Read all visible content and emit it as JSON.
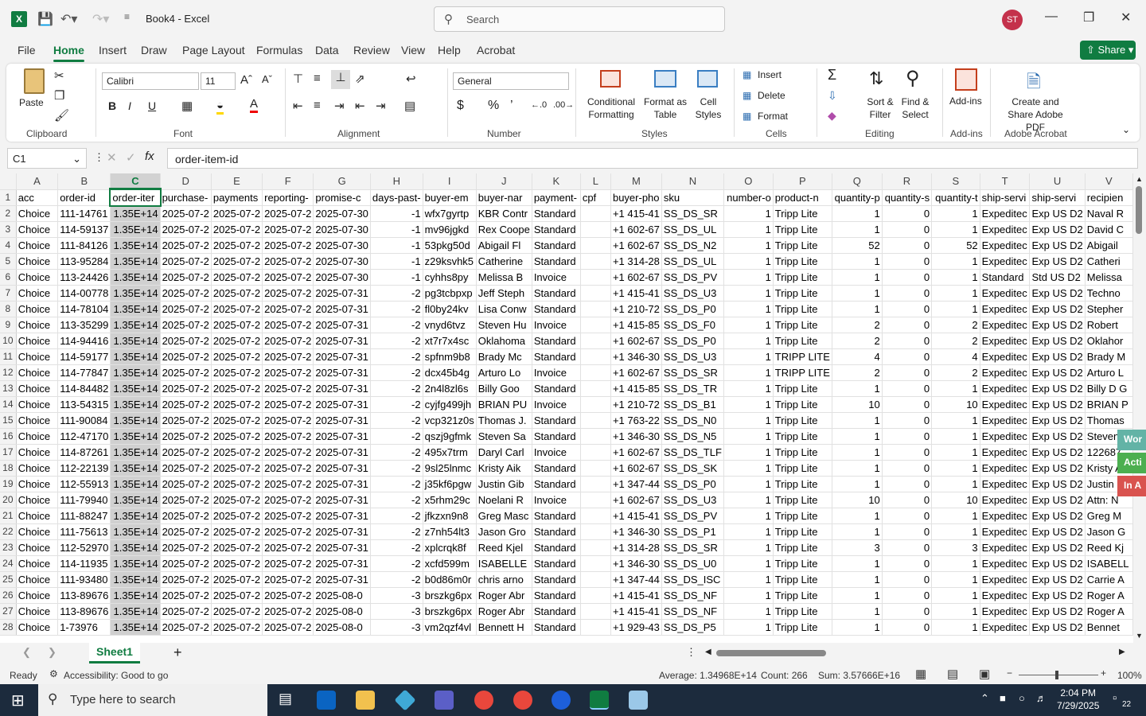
{
  "window": {
    "title": "Book4  -  Excel",
    "search_placeholder": "Search",
    "avatar_initials": "ST"
  },
  "menu_tabs": [
    "File",
    "Home",
    "Insert",
    "Draw",
    "Page Layout",
    "Formulas",
    "Data",
    "Review",
    "View",
    "Help",
    "Acrobat"
  ],
  "share_label": "Share",
  "ribbon": {
    "clipboard": {
      "paste": "Paste",
      "label": "Clipboard"
    },
    "font": {
      "name": "Calibri",
      "size": "11",
      "label": "Font"
    },
    "alignment": {
      "label": "Alignment"
    },
    "number": {
      "format": "General",
      "label": "Number"
    },
    "styles": {
      "conditional": "Conditional Formatting",
      "format_table": "Format as Table",
      "cell_styles": "Cell Styles",
      "label": "Styles"
    },
    "cells": {
      "insert": "Insert",
      "delete": "Delete",
      "format": "Format",
      "label": "Cells"
    },
    "editing": {
      "sort": "Sort & Filter",
      "find": "Find & Select",
      "label": "Editing"
    },
    "addins": {
      "button": "Add-ins",
      "label": "Add-ins"
    },
    "acrobat": {
      "button": "Create and Share Adobe PDF",
      "label": "Adobe Acrobat"
    }
  },
  "formula_bar": {
    "name_box": "C1",
    "formula": "order-item-id"
  },
  "columns": [
    "A",
    "B",
    "C",
    "D",
    "E",
    "F",
    "G",
    "H",
    "I",
    "J",
    "K",
    "L",
    "M",
    "N",
    "O",
    "P",
    "Q",
    "R",
    "S",
    "T",
    "U",
    "V"
  ],
  "headers": [
    "acc",
    "order-id",
    "order-iter",
    "purchase-",
    "payments",
    "reporting-",
    "promise-c",
    "days-past-",
    "buyer-em",
    "buyer-nar",
    "payment-",
    "cpf",
    "buyer-pho",
    "sku",
    "number-o",
    "product-n",
    "quantity-p",
    "quantity-s",
    "quantity-t",
    "ship-servi",
    "ship-servi",
    "recipien"
  ],
  "rows": [
    [
      "Choice",
      "111-14761",
      "1.35E+14",
      "2025-07-2",
      "2025-07-2",
      "2025-07-2",
      "2025-07-30",
      "-1",
      "wfx7gyrtp",
      "KBR Contr",
      "Standard",
      "",
      "+1 415-41",
      "SS_DS_SR",
      "1",
      "Tripp Lite",
      "1",
      "0",
      "1",
      "Expeditec",
      "Exp US D2",
      "Naval R"
    ],
    [
      "Choice",
      "114-59137",
      "1.35E+14",
      "2025-07-2",
      "2025-07-2",
      "2025-07-2",
      "2025-07-30",
      "-1",
      "mv96jgkd",
      "Rex Coope",
      "Standard",
      "",
      "+1 602-67",
      "SS_DS_UL",
      "1",
      "Tripp Lite",
      "1",
      "0",
      "1",
      "Expeditec",
      "Exp US D2",
      "David C"
    ],
    [
      "Choice",
      "111-84126",
      "1.35E+14",
      "2025-07-2",
      "2025-07-2",
      "2025-07-2",
      "2025-07-30",
      "-1",
      "53pkg50d",
      "Abigail Fl",
      "Standard",
      "",
      "+1 602-67",
      "SS_DS_N2",
      "1",
      "Tripp Lite",
      "52",
      "0",
      "52",
      "Expeditec",
      "Exp US D2",
      "Abigail"
    ],
    [
      "Choice",
      "113-95284",
      "1.35E+14",
      "2025-07-2",
      "2025-07-2",
      "2025-07-2",
      "2025-07-30",
      "-1",
      "z29ksvhk5",
      "Catherine",
      "Standard",
      "",
      "+1 314-28",
      "SS_DS_UL",
      "1",
      "Tripp Lite",
      "1",
      "0",
      "1",
      "Expeditec",
      "Exp US D2",
      "Catheri"
    ],
    [
      "Choice",
      "113-24426",
      "1.35E+14",
      "2025-07-2",
      "2025-07-2",
      "2025-07-2",
      "2025-07-30",
      "-1",
      "cyhhs8py",
      "Melissa B",
      "Invoice",
      "",
      "+1 602-67",
      "SS_DS_PV",
      "1",
      "Tripp Lite",
      "1",
      "0",
      "1",
      "Standard",
      "Std US D2",
      "Melissa"
    ],
    [
      "Choice",
      "114-00778",
      "1.35E+14",
      "2025-07-2",
      "2025-07-2",
      "2025-07-2",
      "2025-07-31",
      "-2",
      "pg3tcbpxp",
      "Jeff Steph",
      "Standard",
      "",
      "+1 415-41",
      "SS_DS_U3",
      "1",
      "Tripp Lite",
      "1",
      "0",
      "1",
      "Expeditec",
      "Exp US D2",
      "Techno"
    ],
    [
      "Choice",
      "114-78104",
      "1.35E+14",
      "2025-07-2",
      "2025-07-2",
      "2025-07-2",
      "2025-07-31",
      "-2",
      "fl0by24kv",
      "Lisa Conw",
      "Standard",
      "",
      "+1 210-72",
      "SS_DS_P0",
      "1",
      "Tripp Lite",
      "1",
      "0",
      "1",
      "Expeditec",
      "Exp US D2",
      "Stepher"
    ],
    [
      "Choice",
      "113-35299",
      "1.35E+14",
      "2025-07-2",
      "2025-07-2",
      "2025-07-2",
      "2025-07-31",
      "-2",
      "vnyd6tvz",
      "Steven Hu",
      "Invoice",
      "",
      "+1 415-85",
      "SS_DS_F0",
      "1",
      "Tripp Lite",
      "2",
      "0",
      "2",
      "Expeditec",
      "Exp US D2",
      "Robert"
    ],
    [
      "Choice",
      "114-94416",
      "1.35E+14",
      "2025-07-2",
      "2025-07-2",
      "2025-07-2",
      "2025-07-31",
      "-2",
      "xt7r7x4sc",
      "Oklahoma",
      "Standard",
      "",
      "+1 602-67",
      "SS_DS_P0",
      "1",
      "Tripp Lite",
      "2",
      "0",
      "2",
      "Expeditec",
      "Exp US D2",
      "Oklahor"
    ],
    [
      "Choice",
      "114-59177",
      "1.35E+14",
      "2025-07-2",
      "2025-07-2",
      "2025-07-2",
      "2025-07-31",
      "-2",
      "spfnm9b8",
      "Brady Mc",
      "Standard",
      "",
      "+1 346-30",
      "SS_DS_U3",
      "1",
      "TRIPP LITE",
      "4",
      "0",
      "4",
      "Expeditec",
      "Exp US D2",
      "Brady M"
    ],
    [
      "Choice",
      "114-77847",
      "1.35E+14",
      "2025-07-2",
      "2025-07-2",
      "2025-07-2",
      "2025-07-31",
      "-2",
      "dcx45b4g",
      "Arturo Lo",
      "Invoice",
      "",
      "+1 602-67",
      "SS_DS_SR",
      "1",
      "TRIPP LITE",
      "2",
      "0",
      "2",
      "Expeditec",
      "Exp US D2",
      "Arturo L"
    ],
    [
      "Choice",
      "114-84482",
      "1.35E+14",
      "2025-07-2",
      "2025-07-2",
      "2025-07-2",
      "2025-07-31",
      "-2",
      "2n4l8zl6s",
      "Billy Goo",
      "Standard",
      "",
      "+1 415-85",
      "SS_DS_TR",
      "1",
      "Tripp Lite",
      "1",
      "0",
      "1",
      "Expeditec",
      "Exp US D2",
      "Billy D G"
    ],
    [
      "Choice",
      "113-54315",
      "1.35E+14",
      "2025-07-2",
      "2025-07-2",
      "2025-07-2",
      "2025-07-31",
      "-2",
      "cyjfg499jh",
      "BRIAN PU",
      "Invoice",
      "",
      "+1 210-72",
      "SS_DS_B1",
      "1",
      "Tripp Lite",
      "10",
      "0",
      "10",
      "Expeditec",
      "Exp US D2",
      "BRIAN P"
    ],
    [
      "Choice",
      "111-90084",
      "1.35E+14",
      "2025-07-2",
      "2025-07-2",
      "2025-07-2",
      "2025-07-31",
      "-2",
      "vcp321z0s",
      "Thomas J.",
      "Standard",
      "",
      "+1 763-22",
      "SS_DS_N0",
      "1",
      "Tripp Lite",
      "1",
      "0",
      "1",
      "Expeditec",
      "Exp US D2",
      "Thomas"
    ],
    [
      "Choice",
      "112-47170",
      "1.35E+14",
      "2025-07-2",
      "2025-07-2",
      "2025-07-2",
      "2025-07-31",
      "-2",
      "qszj9gfmk",
      "Steven Sa",
      "Standard",
      "",
      "+1 346-30",
      "SS_DS_N5",
      "1",
      "Tripp Lite",
      "1",
      "0",
      "1",
      "Expeditec",
      "Exp US D2",
      "Steven"
    ],
    [
      "Choice",
      "114-87261",
      "1.35E+14",
      "2025-07-2",
      "2025-07-2",
      "2025-07-2",
      "2025-07-31",
      "-2",
      "495x7trm",
      "Daryl Carl",
      "Invoice",
      "",
      "+1 602-67",
      "SS_DS_TLF",
      "1",
      "Tripp Lite",
      "1",
      "0",
      "1",
      "Expeditec",
      "Exp US D2",
      "122687"
    ],
    [
      "Choice",
      "112-22139",
      "1.35E+14",
      "2025-07-2",
      "2025-07-2",
      "2025-07-2",
      "2025-07-31",
      "-2",
      "9sl25lnmc",
      "Kristy Aik",
      "Standard",
      "",
      "+1 602-67",
      "SS_DS_SK",
      "1",
      "Tripp Lite",
      "1",
      "0",
      "1",
      "Expeditec",
      "Exp US D2",
      "Kristy A"
    ],
    [
      "Choice",
      "112-55913",
      "1.35E+14",
      "2025-07-2",
      "2025-07-2",
      "2025-07-2",
      "2025-07-31",
      "-2",
      "j35kf6pgw",
      "Justin Gib",
      "Standard",
      "",
      "+1 347-44",
      "SS_DS_P0",
      "1",
      "Tripp Lite",
      "1",
      "0",
      "1",
      "Expeditec",
      "Exp US D2",
      "Justin"
    ],
    [
      "Choice",
      "111-79940",
      "1.35E+14",
      "2025-07-2",
      "2025-07-2",
      "2025-07-2",
      "2025-07-31",
      "-2",
      "x5rhm29c",
      "Noelani R",
      "Invoice",
      "",
      "+1 602-67",
      "SS_DS_U3",
      "1",
      "Tripp Lite",
      "10",
      "0",
      "10",
      "Expeditec",
      "Exp US D2",
      "Attn: N"
    ],
    [
      "Choice",
      "111-88247",
      "1.35E+14",
      "2025-07-2",
      "2025-07-2",
      "2025-07-2",
      "2025-07-31",
      "-2",
      "jfkzxn9n8",
      "Greg Masc",
      "Standard",
      "",
      "+1 415-41",
      "SS_DS_PV",
      "1",
      "Tripp Lite",
      "1",
      "0",
      "1",
      "Expeditec",
      "Exp US D2",
      "Greg M"
    ],
    [
      "Choice",
      "111-75613",
      "1.35E+14",
      "2025-07-2",
      "2025-07-2",
      "2025-07-2",
      "2025-07-31",
      "-2",
      "z7nh54lt3",
      "Jason Gro",
      "Standard",
      "",
      "+1 346-30",
      "SS_DS_P1",
      "1",
      "Tripp Lite",
      "1",
      "0",
      "1",
      "Expeditec",
      "Exp US D2",
      "Jason G"
    ],
    [
      "Choice",
      "112-52970",
      "1.35E+14",
      "2025-07-2",
      "2025-07-2",
      "2025-07-2",
      "2025-07-31",
      "-2",
      "xplcrqk8f",
      "Reed Kjel",
      "Standard",
      "",
      "+1 314-28",
      "SS_DS_SR",
      "1",
      "Tripp Lite",
      "3",
      "0",
      "3",
      "Expeditec",
      "Exp US D2",
      "Reed Kj"
    ],
    [
      "Choice",
      "114-11935",
      "1.35E+14",
      "2025-07-2",
      "2025-07-2",
      "2025-07-2",
      "2025-07-31",
      "-2",
      "xcfd599m",
      "ISABELLE",
      "Standard",
      "",
      "+1 346-30",
      "SS_DS_U0",
      "1",
      "Tripp Lite",
      "1",
      "0",
      "1",
      "Expeditec",
      "Exp US D2",
      "ISABELL"
    ],
    [
      "Choice",
      "111-93480",
      "1.35E+14",
      "2025-07-2",
      "2025-07-2",
      "2025-07-2",
      "2025-07-31",
      "-2",
      "b0d86m0r",
      "chris arno",
      "Standard",
      "",
      "+1 347-44",
      "SS_DS_ISC",
      "1",
      "Tripp Lite",
      "1",
      "0",
      "1",
      "Expeditec",
      "Exp US D2",
      "Carrie A"
    ],
    [
      "Choice",
      "113-89676",
      "1.35E+14",
      "2025-07-2",
      "2025-07-2",
      "2025-07-2",
      "2025-08-0",
      "-3",
      "brszkg6px",
      "Roger Abr",
      "Standard",
      "",
      "+1 415-41",
      "SS_DS_NF",
      "1",
      "Tripp Lite",
      "1",
      "0",
      "1",
      "Expeditec",
      "Exp US D2",
      "Roger A"
    ],
    [
      "Choice",
      "113-89676",
      "1.35E+14",
      "2025-07-2",
      "2025-07-2",
      "2025-07-2",
      "2025-08-0",
      "-3",
      "brszkg6px",
      "Roger Abr",
      "Standard",
      "",
      "+1 415-41",
      "SS_DS_NF",
      "1",
      "Tripp Lite",
      "1",
      "0",
      "1",
      "Expeditec",
      "Exp US D2",
      "Roger A"
    ],
    [
      "Choice",
      "1-73976",
      "1.35E+14",
      "2025-07-2",
      "2025-07-2",
      "2025-07-2",
      "2025-08-0",
      "-3",
      "vm2qzf4vl",
      "Bennett H",
      "Standard",
      "",
      "+1 929-43",
      "SS_DS_P5",
      "1",
      "Tripp Lite",
      "1",
      "0",
      "1",
      "Expeditec",
      "Exp US D2",
      "Bennet"
    ]
  ],
  "sheet_tab": "Sheet1",
  "status": {
    "ready": "Ready",
    "accessibility": "Accessibility: Good to go",
    "average": "Average: 1.34968E+14",
    "count": "Count: 266",
    "sum": "Sum: 3.57666E+16",
    "zoom": "100%"
  },
  "side_flags": [
    "Wor",
    "Acti",
    "In A"
  ],
  "taskbar": {
    "search_placeholder": "Type here to search",
    "time": "2:04 PM",
    "date": "7/29/2025",
    "notifications": "22"
  }
}
